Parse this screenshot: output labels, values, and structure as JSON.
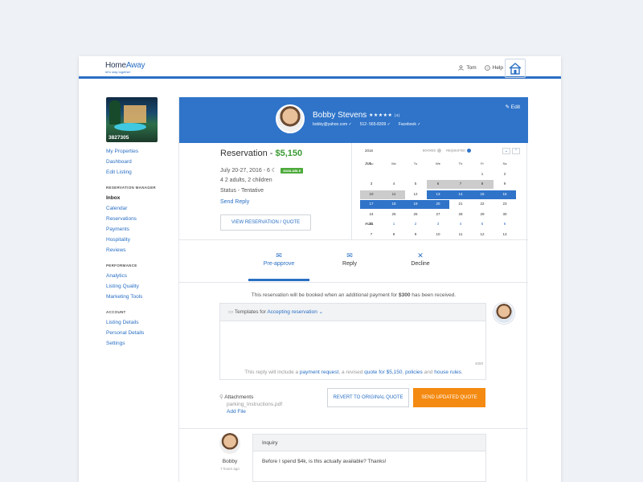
{
  "header": {
    "brand_home": "Home",
    "brand_away": "Away",
    "tagline": "let's stay together",
    "user": "Tom",
    "help": "Help"
  },
  "sidebar": {
    "property_id": "3827305",
    "links_top": [
      "My Properties",
      "Dashboard",
      "Edit Listing"
    ],
    "section_reservation": "RESERVATION MANAGER",
    "links_reservation": [
      "Inbox",
      "Calendar",
      "Reservations",
      "Payments",
      "Hospitality",
      "Reviews"
    ],
    "section_performance": "PERFORMANCE",
    "links_performance": [
      "Analytics",
      "Listing Quality",
      "Marketing Tools"
    ],
    "section_account": "ACCOUNT",
    "links_account": [
      "Listing Details",
      "Personal Details",
      "Settings"
    ]
  },
  "guest": {
    "name": "Bobby Stevens",
    "stars": "★★★★★",
    "review_count": "(4)",
    "email": "bobby@yahoo.com ✓",
    "phone": "512- 565-8309 ✓",
    "facebook": "Facebook ✓",
    "edit_label": "Edit"
  },
  "reservation": {
    "title": "Reservation - ",
    "price": "$5,150",
    "dates": "July 20-27, 2016 - 6",
    "available_badge": "AVAILABLE",
    "guests": "4  2 adults, 2 children",
    "status": "Status - Tentative",
    "send_reply": "Send Reply",
    "view_button": "VIEW RESERVATION / QUOTE"
  },
  "calendar": {
    "year": "2016",
    "legend_booked": "BOOKED",
    "legend_requested": "REQUESTED",
    "booked_color": "#cccccc",
    "requested_color": "#2f74c9",
    "month_jul": "JUL",
    "month_aug": "AUG",
    "weekdays": [
      "Su",
      "Mo",
      "Tu",
      "We",
      "Th",
      "Fr",
      "Sa"
    ],
    "rows": [
      [
        "",
        "",
        "",
        "",
        "",
        "1",
        "2"
      ],
      [
        "3",
        "4",
        "5",
        "6",
        "7",
        "8",
        "9"
      ],
      [
        "10",
        "11",
        "12",
        "13",
        "14",
        "15",
        "16"
      ],
      [
        "17",
        "18",
        "19",
        "20",
        "21",
        "22",
        "23"
      ],
      [
        "24",
        "25",
        "26",
        "27",
        "28",
        "29",
        "30"
      ],
      [
        "31",
        "1",
        "2",
        "3",
        "4",
        "5",
        "6"
      ],
      [
        "7",
        "8",
        "9",
        "10",
        "11",
        "12",
        "13"
      ]
    ]
  },
  "actions": {
    "preapprove": "Pre-approve",
    "reply": "Reply",
    "decline": "Decline"
  },
  "payment_note": {
    "before": "This reservation will be booked when an additional payment for ",
    "amount": "$300",
    "after": " has been received."
  },
  "reply": {
    "templates_label": "Templates for ",
    "template_name": "Accepting reservation",
    "counter": "4000",
    "foot_1": "This reply will include a ",
    "link_payment": "payment request",
    "foot_2": ", a revised ",
    "link_quote": "quote for $5,150",
    "foot_3": ", ",
    "link_policies": "policies",
    "foot_4": " and ",
    "link_rules": "house rules",
    "foot_5": "."
  },
  "attachments": {
    "label": "Attachments",
    "file": "parking_Instructions.pdf",
    "add": "Add File"
  },
  "buttons": {
    "revert": "REVERT TO ORIGINAL QUOTE",
    "send": "SEND UPDATED QUOTE"
  },
  "message": {
    "author": "Bobby",
    "time": "7 hours ago",
    "type": "Inquiry",
    "body": "Before I spend $4k, is this actually available?  Thanks!"
  }
}
